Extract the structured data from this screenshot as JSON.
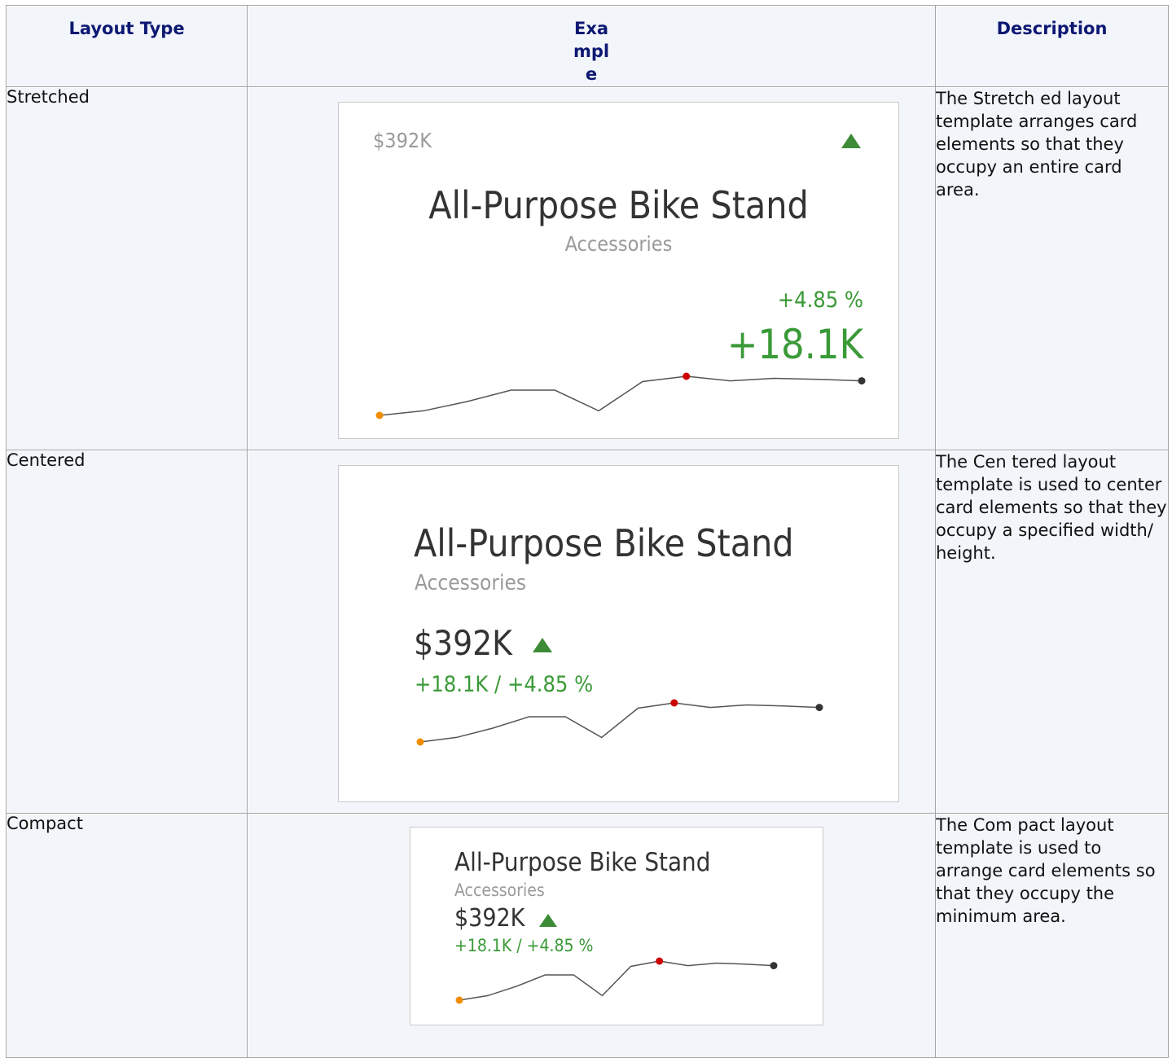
{
  "headers": {
    "layout_type": "Layout Type",
    "example": "Example",
    "description": "Description"
  },
  "colors": {
    "header_text": "#0d1873",
    "cell_background": "#f2f5fa",
    "positive": "#3a9a37",
    "triangle": "#3d8b37",
    "spark_start": "#f28c00",
    "spark_max": "#cc0000",
    "spark_end": "#333333"
  },
  "sparkline_values": [
    0.0,
    0.18,
    0.55,
    1.0,
    1.0,
    0.18,
    1.34,
    1.55,
    1.37,
    1.47,
    1.43,
    1.37
  ],
  "rows": [
    {
      "type": "Stretched",
      "description": "The Stretch ed layout template arranges card elements so that they occupy an entire card area.",
      "card": {
        "actual_value": "$392K",
        "title": "All-Purpose Bike Stand",
        "subtitle": "Accessories",
        "percent_variation": "+4.85 %",
        "absolute_variation": "+18.1K",
        "indicator": "up-triangle-icon"
      }
    },
    {
      "type": "Centered",
      "description": "The Cen tered layout template is used to center card elements so that they occupy a specified width/ height.",
      "card": {
        "title": "All-Purpose Bike Stand",
        "subtitle": "Accessories",
        "actual_value": "$392K",
        "variation": "+18.1K / +4.85 %",
        "indicator": "up-triangle-icon"
      }
    },
    {
      "type": "Compact",
      "description": "The Com pact layout template is used to arrange card elements so that they occupy the minimum area.",
      "card": {
        "title": "All-Purpose Bike Stand",
        "subtitle": "Accessories",
        "actual_value": "$392K",
        "variation": "+18.1K / +4.85 %",
        "indicator": "up-triangle-icon"
      }
    }
  ]
}
